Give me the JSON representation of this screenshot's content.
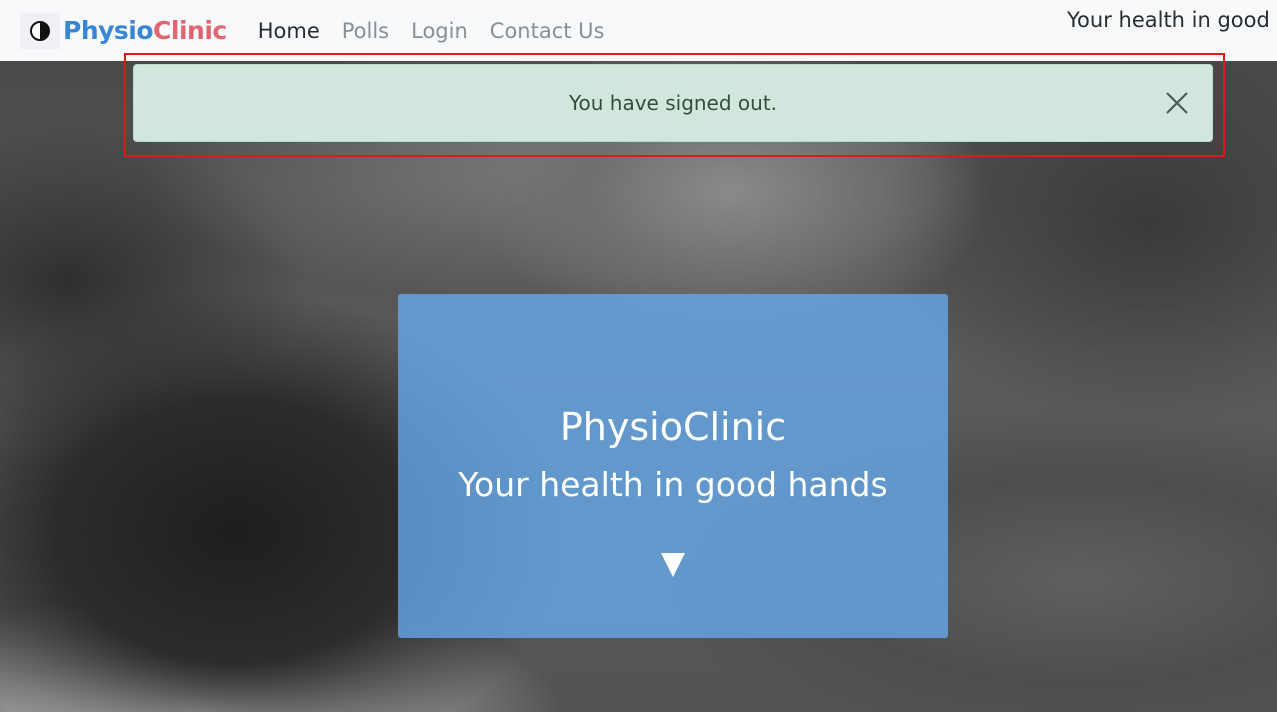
{
  "navbar": {
    "brand_part1": "Physio",
    "brand_part2": "Clinic",
    "links": [
      {
        "label": "Home"
      },
      {
        "label": "Polls"
      },
      {
        "label": "Login"
      },
      {
        "label": "Contact Us"
      }
    ],
    "tagline": "Your health in good hands"
  },
  "alert": {
    "message": "You have signed out.",
    "close_icon": "close-icon"
  },
  "hero": {
    "title": "PhysioClinic",
    "subtitle": "Your health in good hands",
    "arrow_icon": "triangle-down-icon"
  },
  "colors": {
    "brand_blue": "#3a86d6",
    "brand_red": "#e06772",
    "alert_bg": "#d1e7dd",
    "card_bg": "#67aaee",
    "highlight": "#e01818"
  }
}
